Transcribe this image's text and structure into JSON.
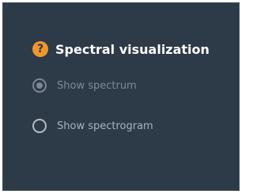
{
  "panel": {
    "title": "Spectral visualization",
    "help_icon": "question-mark-icon",
    "help_glyph": "?",
    "accent_color": "#f0962e",
    "background_color": "#2d3a48"
  },
  "options": [
    {
      "label": "Show spectrum",
      "selected": true
    },
    {
      "label": "Show spectrogram",
      "selected": false
    }
  ]
}
